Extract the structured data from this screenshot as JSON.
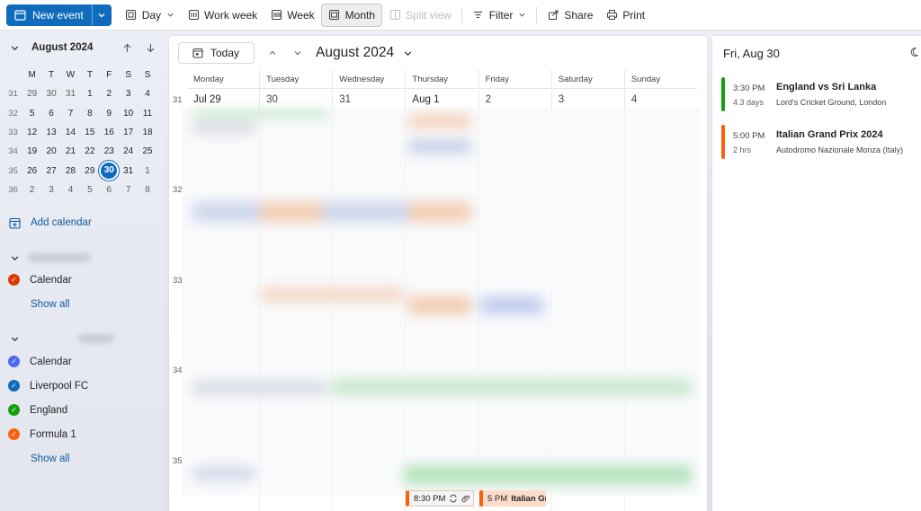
{
  "toolbar": {
    "new_event": "New event",
    "day": "Day",
    "work_week": "Work week",
    "week": "Week",
    "month": "Month",
    "split_view": "Split view",
    "filter": "Filter",
    "share": "Share",
    "print": "Print"
  },
  "mini_calendar": {
    "title": "August 2024",
    "weekday_headers": [
      "M",
      "T",
      "W",
      "T",
      "F",
      "S",
      "S"
    ],
    "weeks": [
      {
        "week": "31",
        "days": [
          "29",
          "30",
          "31",
          "1",
          "2",
          "3",
          "4"
        ]
      },
      {
        "week": "32",
        "days": [
          "5",
          "6",
          "7",
          "8",
          "9",
          "10",
          "11"
        ]
      },
      {
        "week": "33",
        "days": [
          "12",
          "13",
          "14",
          "15",
          "16",
          "17",
          "18"
        ]
      },
      {
        "week": "34",
        "days": [
          "19",
          "20",
          "21",
          "22",
          "23",
          "24",
          "25"
        ]
      },
      {
        "week": "35",
        "days": [
          "26",
          "27",
          "28",
          "29",
          "30",
          "31",
          "1"
        ]
      },
      {
        "week": "36",
        "days": [
          "2",
          "3",
          "4",
          "5",
          "6",
          "7",
          "8"
        ]
      }
    ],
    "today": "30"
  },
  "sidebar": {
    "add_calendar": "Add calendar",
    "group1": {
      "items": [
        {
          "label": "Calendar",
          "color": "#d83b01"
        }
      ],
      "show_all": "Show all"
    },
    "group2": {
      "items": [
        {
          "label": "Calendar",
          "color": "#4f6bed"
        },
        {
          "label": "Liverpool FC",
          "color": "#0f6cbd"
        },
        {
          "label": "England",
          "color": "#13a10e"
        },
        {
          "label": "Formula 1",
          "color": "#f7630c"
        }
      ],
      "show_all": "Show all"
    }
  },
  "calendar": {
    "today_label": "Today",
    "month_title": "August 2024",
    "day_names": [
      "Monday",
      "Tuesday",
      "Wednesday",
      "Thursday",
      "Friday",
      "Saturday",
      "Sunday"
    ],
    "week_numbers": [
      "31",
      "32",
      "33",
      "34",
      "35"
    ],
    "first_row_dates": [
      "Jul 29",
      "30",
      "31",
      "Aug 1",
      "2",
      "3",
      "4"
    ],
    "bottom_events": [
      {
        "time": "8:30 PM",
        "title": ""
      },
      {
        "time": "5 PM",
        "title": "Italian Gra"
      }
    ]
  },
  "agenda": {
    "date_title": "Fri, Aug 30",
    "events": [
      {
        "time": "3:30 PM",
        "duration": "4.3 days",
        "title": "England vs Sri Lanka",
        "location": "Lord's Cricket Ground, London",
        "color": "#13a10e"
      },
      {
        "time": "5:00 PM",
        "duration": "2 hrs",
        "title": "Italian Grand Prix 2024",
        "location": "Autodromo Nazionale Monza (Italy)",
        "color": "#f7630c"
      }
    ]
  },
  "colors": {
    "accent": "#0f6cbd",
    "england": "#13a10e",
    "formula1": "#f7630c"
  }
}
